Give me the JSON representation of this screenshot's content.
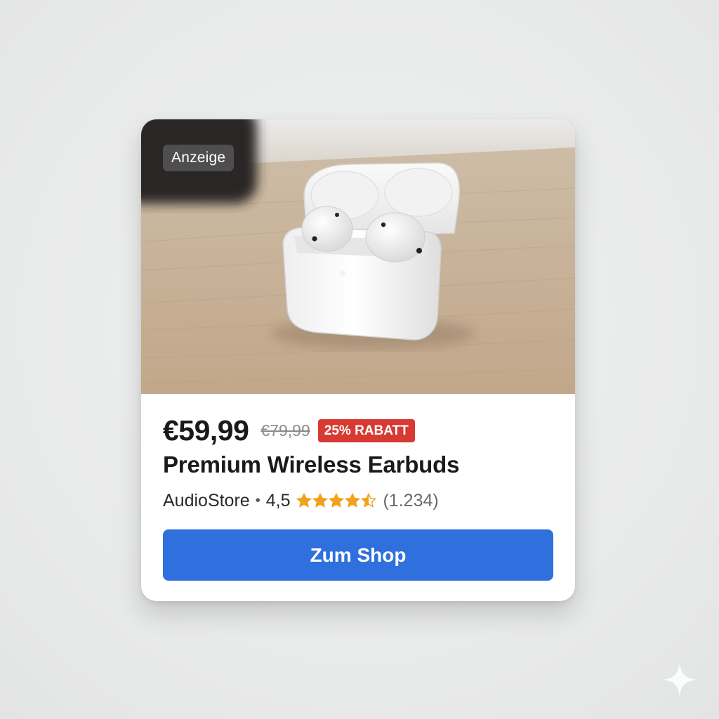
{
  "ad": {
    "badge_label": "Anzeige",
    "image_icon": "earbuds-case-image",
    "price": "€59,99",
    "old_price": "€79,99",
    "discount_label": "25% RABATT",
    "title": "Premium Wireless Earbuds",
    "seller": "AudioStore",
    "separator": "•",
    "rating_text": "4,5",
    "rating_value": 4.5,
    "rating_max": 5,
    "review_count": "(1.234)",
    "cta_label": "Zum Shop"
  },
  "colors": {
    "cta": "#2f6fde",
    "discount_badge": "#d63a32",
    "star": "#f0a21a"
  },
  "decor": {
    "corner_icon": "sparkle-icon"
  }
}
